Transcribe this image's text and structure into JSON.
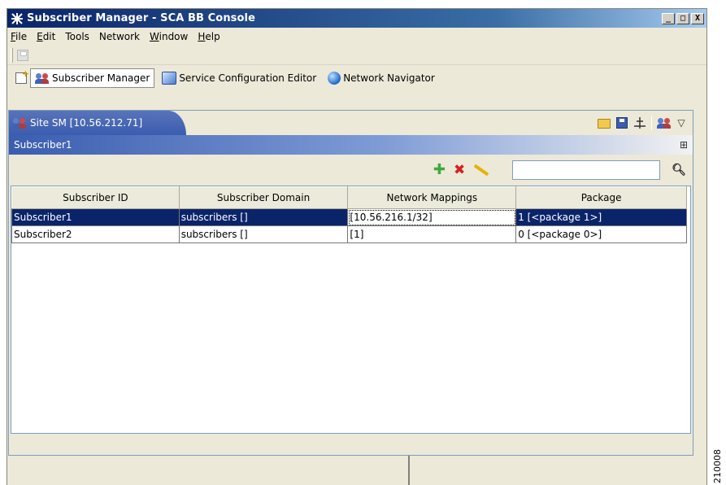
{
  "window": {
    "title": "Subscriber Manager - SCA BB Console",
    "controls": {
      "minimize": "_",
      "maximize": "□",
      "close": "X"
    }
  },
  "menu": [
    {
      "label": "File",
      "mnemonic": "F"
    },
    {
      "label": "Edit",
      "mnemonic": "E"
    },
    {
      "label": "Tools",
      "mnemonic": ""
    },
    {
      "label": "Network",
      "mnemonic": ""
    },
    {
      "label": "Window",
      "mnemonic": "W"
    },
    {
      "label": "Help",
      "mnemonic": "H"
    }
  ],
  "perspectives": [
    {
      "label": "Subscriber Manager",
      "icon": "people-icon",
      "active": true
    },
    {
      "label": "Service Configuration Editor",
      "icon": "config-editor-icon",
      "active": false
    },
    {
      "label": "Network Navigator",
      "icon": "globe-icon",
      "active": false
    }
  ],
  "view": {
    "tab_label": "Site SM [10.56.212.71]",
    "toolbar_icons": [
      "open-folder-icon",
      "save-icon",
      "connect-icon",
      "users-icon",
      "view-menu-icon"
    ]
  },
  "subscriber_panel": {
    "title": "Subscriber1",
    "actions": [
      "add-icon",
      "delete-icon",
      "edit-icon"
    ],
    "search": {
      "value": "",
      "placeholder": ""
    }
  },
  "table": {
    "columns": [
      "Subscriber ID",
      "Subscriber Domain",
      "Network Mappings",
      "Package"
    ],
    "rows": [
      {
        "id": "Subscriber1",
        "domain": "subscribers []",
        "mappings": "[10.56.216.1/32]",
        "package": "1 [<package 1>]",
        "selected": true
      },
      {
        "id": "Subscriber2",
        "domain": "subscribers []",
        "mappings": "[1]",
        "package": "0 [<package 0>]",
        "selected": false
      }
    ]
  },
  "figure_id": "210008",
  "colors": {
    "title_bar": "#0a246a",
    "selection": "#0a246a",
    "view_tab": "#3b5db0",
    "frame": "#ece9d8"
  }
}
